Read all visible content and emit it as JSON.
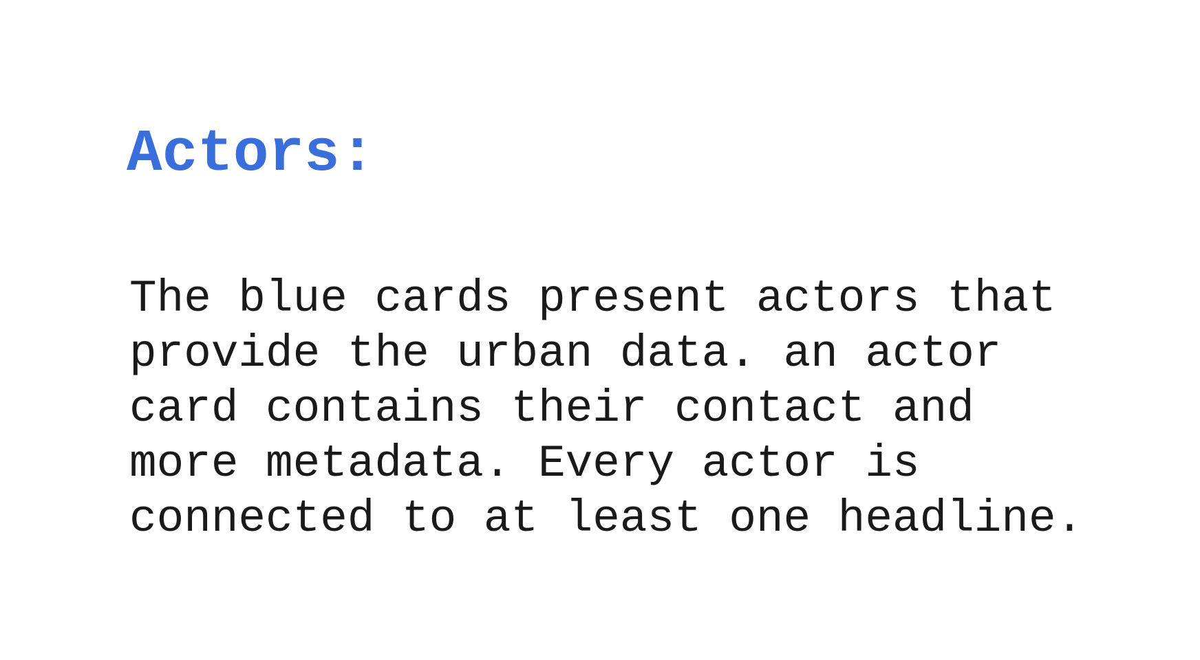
{
  "slide": {
    "heading": "Actors:",
    "body_lines": [
      "The blue cards present actors that",
      "provide the urban data. an actor",
      "card contains their contact and",
      "more metadata. Every actor is",
      "connected to at least one headline."
    ]
  },
  "colors": {
    "heading": "#3a6fdb",
    "body": "#1a1a1a",
    "background": "#ffffff"
  }
}
